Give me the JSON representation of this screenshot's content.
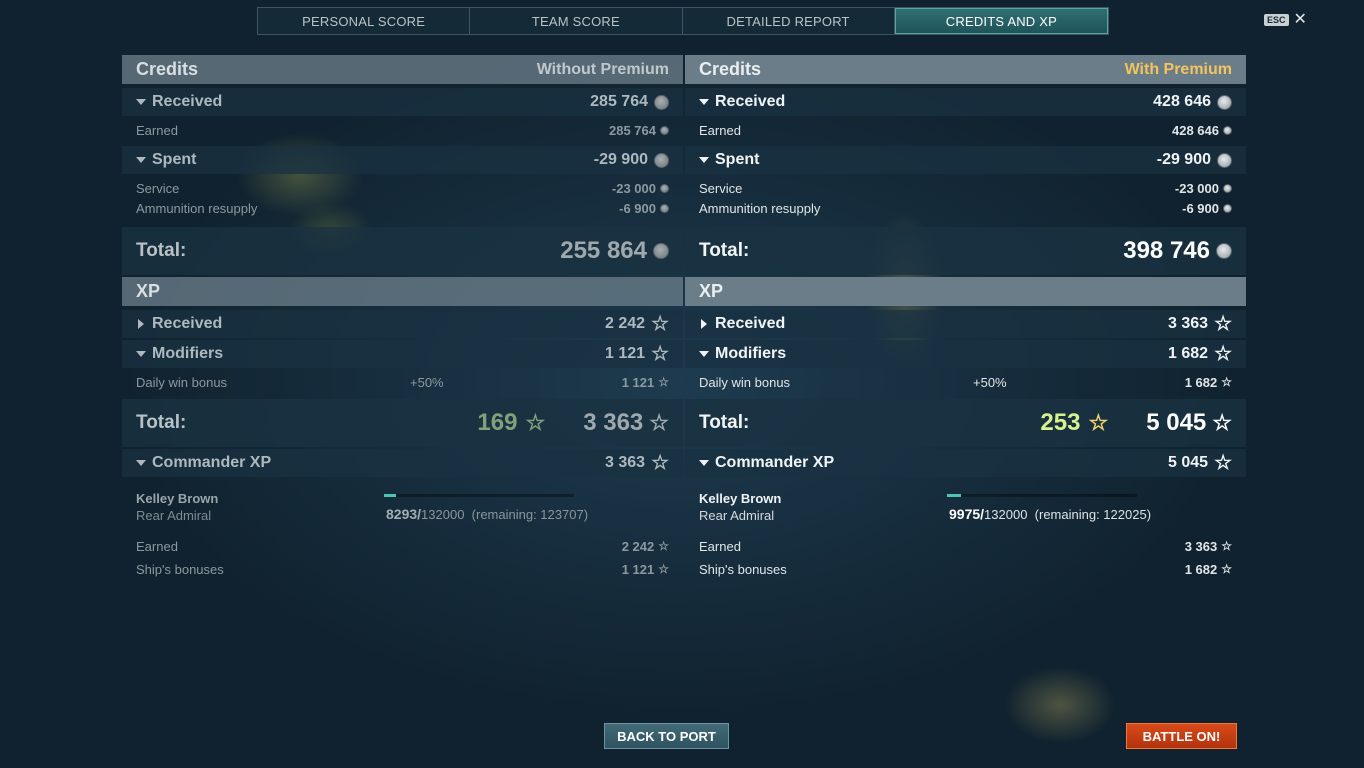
{
  "tabs": [
    {
      "label": "PERSONAL SCORE"
    },
    {
      "label": "TEAM SCORE"
    },
    {
      "label": "DETAILED REPORT"
    },
    {
      "label": "CREDITS AND XP"
    }
  ],
  "esc": {
    "key": "ESC",
    "close": "✕"
  },
  "left": {
    "credits_title": "Credits",
    "mode": "Without Premium",
    "received_label": "Received",
    "received_value": "285 764",
    "earned_label": "Earned",
    "earned_value": "285 764",
    "spent_label": "Spent",
    "spent_value": "-29 900",
    "service_label": "Service",
    "service_value": "-23 000",
    "ammo_label": "Ammunition resupply",
    "ammo_value": "-6 900",
    "credits_total_label": "Total:",
    "credits_total": "255 864",
    "xp_title": "XP",
    "xp_received_label": "Received",
    "xp_received": "2 242",
    "modifiers_label": "Modifiers",
    "modifiers": "1 121",
    "daily_label": "Daily win bonus",
    "daily_pct": "+50%",
    "daily_value": "1 121",
    "xp_total_label": "Total:",
    "xp_bonus": "169",
    "xp_total": "3 363",
    "cmd_label": "Commander XP",
    "cmd_value": "3 363",
    "cmd_name": "Kelley Brown",
    "cmd_rank": "Rear Admiral",
    "cmd_current": "8293/",
    "cmd_max": "132000",
    "cmd_remaining": "(remaining: 123707)",
    "cmd_progress": 0.0628,
    "cmd_earned_label": "Earned",
    "cmd_earned": "2 242",
    "ship_bonus_label": "Ship's bonuses",
    "ship_bonus": "1 121"
  },
  "right": {
    "credits_title": "Credits",
    "mode": "With Premium",
    "received_label": "Received",
    "received_value": "428 646",
    "earned_label": "Earned",
    "earned_value": "428 646",
    "spent_label": "Spent",
    "spent_value": "-29 900",
    "service_label": "Service",
    "service_value": "-23 000",
    "ammo_label": "Ammunition resupply",
    "ammo_value": "-6 900",
    "credits_total_label": "Total:",
    "credits_total": "398 746",
    "xp_title": "XP",
    "xp_received_label": "Received",
    "xp_received": "3 363",
    "modifiers_label": "Modifiers",
    "modifiers": "1 682",
    "daily_label": "Daily win bonus",
    "daily_pct": "+50%",
    "daily_value": "1 682",
    "xp_total_label": "Total:",
    "xp_bonus": "253",
    "xp_total": "5 045",
    "cmd_label": "Commander XP",
    "cmd_value": "5 045",
    "cmd_name": "Kelley Brown",
    "cmd_rank": "Rear Admiral",
    "cmd_current": "9975/",
    "cmd_max": "132000",
    "cmd_remaining": "(remaining: 122025)",
    "cmd_progress": 0.0756,
    "cmd_earned_label": "Earned",
    "cmd_earned": "3 363",
    "ship_bonus_label": "Ship's bonuses",
    "ship_bonus": "1 682"
  },
  "buttons": {
    "back": "BACK TO PORT",
    "battle": "BATTLE ON!"
  },
  "colors": {
    "premium": "#f2c45e",
    "accent": "#4fc3b6",
    "battle": "#d94a1a"
  }
}
